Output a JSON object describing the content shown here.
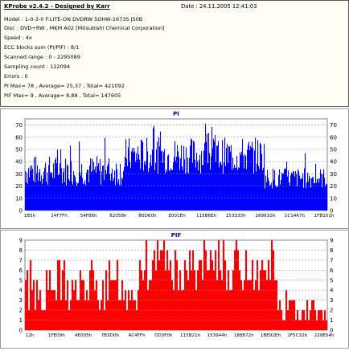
{
  "header": {
    "title": "KProbe v2.4.2 - Designed by Karr",
    "date": "Date : 24.11.2005 12:41:03",
    "lines": [
      "Model : 1-0-3-0 F:LITE-ON DVDRW SOHW-1673S JS0B",
      "Disc : DVD+RW , MKM A02 [Mitsubishi Chemical Corporation]",
      "Speed : 4x",
      "ECC blocks sum (PI/PIF) : 8/1",
      "Scanned range : 0 - 2295089",
      "Sampling count : 122094",
      "Errors : 0",
      "PI Max= 78 , Average= 25,37 , Total= 421092",
      "PIF Max= 9 , Average= 8,88 , Total= 147605"
    ]
  },
  "colors": {
    "pi": "#0000ff",
    "pif": "#ff0000",
    "grid": "#8888cc"
  },
  "chart_data": [
    {
      "type": "area",
      "title": "PI",
      "ylim": [
        0,
        75
      ],
      "yticks": [
        0,
        10,
        20,
        30,
        40,
        50,
        60,
        70
      ],
      "grid": true,
      "xtick_labels": [
        "1B5h",
        "24F7Fh",
        "54F86h",
        "82058h",
        "B0D60h",
        "E001Eh",
        "115B6Eh",
        "153333h",
        "189910h",
        "1C1467h",
        "1FB151h"
      ],
      "segments": [
        {
          "from": 0.0,
          "to": 0.33,
          "low": 20,
          "high": 45
        },
        {
          "from": 0.33,
          "to": 0.79,
          "low": 30,
          "high": 60
        },
        {
          "from": 0.79,
          "to": 1.0,
          "low": 18,
          "high": 35
        }
      ],
      "max": 78
    },
    {
      "type": "area",
      "title": "PIF",
      "ylim": [
        0,
        9
      ],
      "yticks": [
        0,
        1,
        2,
        3,
        4,
        5,
        6,
        7,
        8,
        9
      ],
      "grid": true,
      "xtick_labels": [
        "12h",
        "1FE09h",
        "4E005h",
        "7B3D0h",
        "AC4FFh",
        "DD3F0h",
        "115B21h",
        "153944h",
        "188872h",
        "1BE92Eh",
        "1F5C32h",
        "229E04h"
      ],
      "segments": [
        {
          "from": 0.0,
          "to": 0.38,
          "low": 2,
          "high": 6
        },
        {
          "from": 0.38,
          "to": 0.83,
          "low": 4,
          "high": 8
        },
        {
          "from": 0.83,
          "to": 1.0,
          "low": 1,
          "high": 3
        }
      ],
      "max": 9
    }
  ]
}
